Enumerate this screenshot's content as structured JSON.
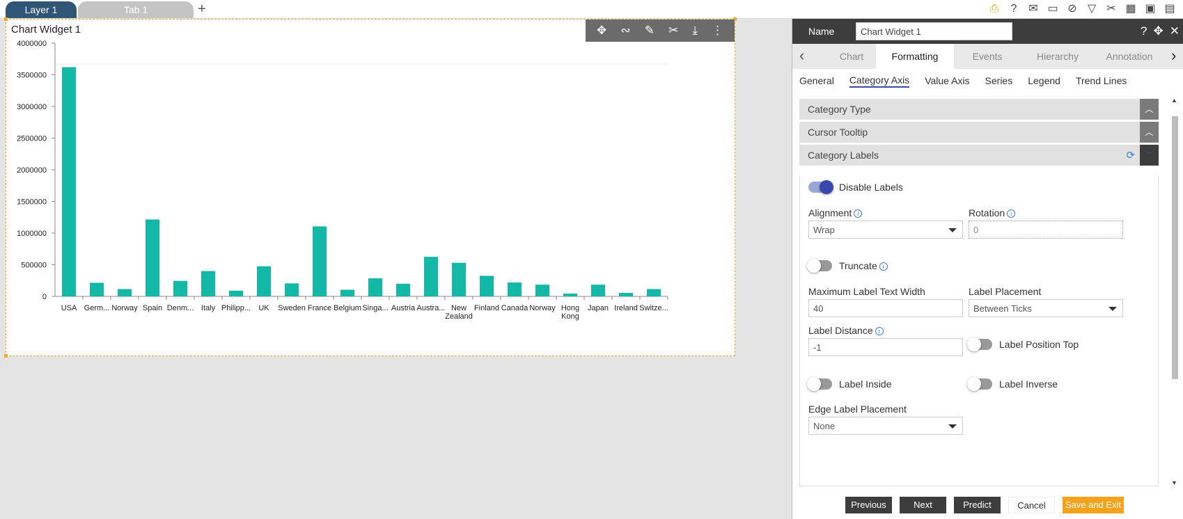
{
  "tabs": {
    "layer": "Layer 1",
    "tab": "Tab 1",
    "add": "+"
  },
  "top_icons": [
    "save-icon",
    "help-icon",
    "mail-icon",
    "comment-icon",
    "clear-filter-icon",
    "filter-icon",
    "tools-icon",
    "table-icon",
    "screen-icon",
    "grid-icon"
  ],
  "widget": {
    "title": "Chart Widget 1"
  },
  "chart_data": {
    "type": "bar",
    "color": "#14b8a6",
    "categories": [
      "USA",
      "Germ...",
      "Norway",
      "Spain",
      "Denm...",
      "Italy",
      "Philipp...",
      "UK",
      "Sweden",
      "France",
      "Belgium",
      "Singa...",
      "Austria",
      "Austra...",
      "New Zealand",
      "Finland",
      "Canada",
      "Norway",
      "Hong Kong",
      "Japan",
      "Ireland",
      "Switze..."
    ],
    "values": [
      3620000,
      215000,
      115000,
      1215000,
      245000,
      400000,
      90000,
      475000,
      205000,
      1105000,
      105000,
      285000,
      200000,
      625000,
      530000,
      325000,
      220000,
      185000,
      45000,
      185000,
      55000,
      115000
    ],
    "yticks": [
      "0",
      "500000",
      "1000000",
      "1500000",
      "2000000",
      "2500000",
      "3000000",
      "3500000",
      "4000000"
    ],
    "ylim": [
      0,
      4000000
    ]
  },
  "panel": {
    "name_label": "Name",
    "name_value": "Chart Widget 1",
    "tabs": [
      "Chart",
      "Formatting",
      "Events",
      "Hierarchy",
      "Annotation"
    ],
    "subtabs": [
      "General",
      "Category Axis",
      "Value Axis",
      "Series",
      "Legend",
      "Trend Lines"
    ],
    "sections": {
      "category_type": "Category Type",
      "cursor_tooltip": "Cursor Tooltip",
      "category_labels": "Category Labels"
    },
    "disable_labels": "Disable Labels",
    "alignment_label": "Alignment",
    "alignment_value": "Wrap",
    "rotation_label": "Rotation",
    "rotation_value": "0",
    "truncate": "Truncate",
    "max_width_label": "Maximum Label Text Width",
    "max_width_value": "40",
    "placement_label": "Label Placement",
    "placement_value": "Between Ticks",
    "distance_label": "Label Distance",
    "distance_value": "-1",
    "position_top": "Label Position Top",
    "label_inside": "Label Inside",
    "label_inverse": "Label Inverse",
    "edge_label": "Edge Label Placement",
    "edge_value": "None"
  },
  "footer": {
    "previous": "Previous",
    "next": "Next",
    "predict": "Predict",
    "cancel": "Cancel",
    "save_exit": "Save and Exit"
  }
}
